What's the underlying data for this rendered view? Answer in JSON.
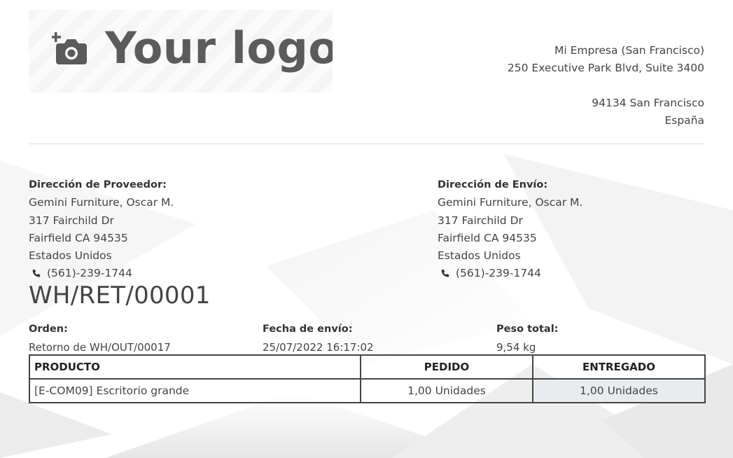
{
  "logo": {
    "text": "Your logo",
    "icon": "add-photo-icon"
  },
  "company": {
    "name": "Mi Empresa (San Francisco)",
    "street": "250 Executive Park Blvd, Suite 3400",
    "city": "94134 San Francisco",
    "country": "España"
  },
  "vendor_address": {
    "label": "Dirección de Proveedor:",
    "name": "Gemini Furniture, Oscar M.",
    "street": "317 Fairchild Dr",
    "city": "Fairfield CA 94535",
    "country": "Estados Unidos",
    "phone": "(561)-239-1744"
  },
  "shipping_address": {
    "label": "Dirección de Envío:",
    "name": "Gemini Furniture, Oscar M.",
    "street": "317 Fairchild Dr",
    "city": "Fairfield CA 94535",
    "country": "Estados Unidos",
    "phone": "(561)-239-1744"
  },
  "document": {
    "reference": "WH/RET/00001"
  },
  "info": {
    "order": {
      "label": "Orden:",
      "value": "Retorno de WH/OUT/00017"
    },
    "ship_date": {
      "label": "Fecha de envío:",
      "value": "25/07/2022 16:17:02"
    },
    "weight": {
      "label": "Peso total:",
      "value": "9,54 kg"
    }
  },
  "table": {
    "headers": {
      "product": "PRODUCTO",
      "ordered": "PEDIDO",
      "delivered": "ENTREGADO"
    },
    "rows": [
      {
        "product": "[E-COM09] Escritorio grande",
        "ordered": "1,00 Unidades",
        "delivered": "1,00 Unidades"
      }
    ]
  },
  "colors": {
    "text": "#444444",
    "border": "#444444",
    "shaded_cell": "#e9ecef",
    "logo": "#5b5b5b"
  }
}
